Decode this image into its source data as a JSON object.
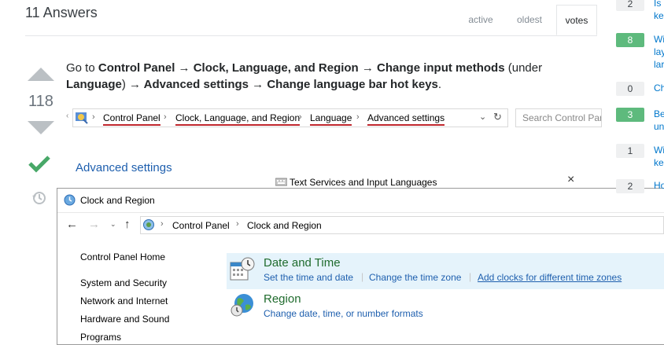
{
  "header": {
    "title": "11 Answers",
    "tabs": [
      "active",
      "oldest",
      "votes"
    ]
  },
  "vote": {
    "count": "118"
  },
  "answer": {
    "p1": "Go to ",
    "b1": "Control Panel → Clock, Language, and Region → Change input methods",
    "p2": " (under ",
    "b2": "Language",
    "p3": ") ",
    "b3": "→ Advanced settings → Change language bar hot keys",
    "p4": "."
  },
  "addr_bar": {
    "crumbs": [
      "Control Panel",
      "Clock, Language, and Region",
      "Language",
      "Advanced settings"
    ],
    "search_placeholder": "Search Control Panel"
  },
  "advanced": {
    "heading": "Advanced settings",
    "dialog_title": "Text Services and Input Languages",
    "close": "×"
  },
  "window": {
    "title": "Clock and Region",
    "crumbs": [
      "Control Panel",
      "Clock and Region"
    ],
    "sidebar": [
      "Control Panel Home",
      "System and Security",
      "Network and Internet",
      "Hardware and Sound",
      "Programs"
    ],
    "categories": [
      {
        "title": "Date and Time",
        "links": [
          "Set the time and date",
          "Change the time zone",
          "Add clocks for different time zones"
        ]
      },
      {
        "title": "Region",
        "links": [
          "Change date, time, or number formats"
        ]
      }
    ]
  },
  "related": [
    {
      "count": "2",
      "text": "Is",
      "text2": "ke",
      "accepted": false
    },
    {
      "count": "8",
      "text": "Wi",
      "text2": "lay",
      "text3": "lar",
      "accepted": true
    },
    {
      "count": "0",
      "text": "Ch",
      "accepted": false
    },
    {
      "count": "3",
      "text": "Be",
      "text2": "un",
      "accepted": true
    },
    {
      "count": "1",
      "text": "Wi",
      "text2": "ke",
      "accepted": false
    },
    {
      "count": "2",
      "text": "Ho",
      "accepted": false
    }
  ]
}
